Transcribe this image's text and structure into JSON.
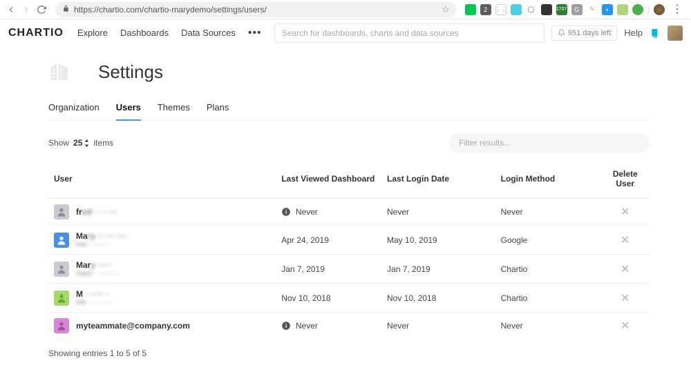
{
  "browser": {
    "url": "https://chartio.com/chartio-marydemo/settings/users/"
  },
  "topnav": {
    "logo": "CHARTIO",
    "links": [
      "Explore",
      "Dashboards",
      "Data Sources"
    ],
    "search_placeholder": "Search for dashboards, charts and data sources",
    "days_left": "951 days left",
    "help": "Help"
  },
  "page": {
    "title": "Settings",
    "tabs": [
      "Organization",
      "Users",
      "Themes",
      "Plans"
    ],
    "active_tab": 1,
    "show_label": "Show",
    "show_value": "25",
    "items_label": "items",
    "filter_placeholder": "Filter results...",
    "columns": {
      "user": "User",
      "last_viewed": "Last Viewed Dashboard",
      "last_login": "Last Login Date",
      "login_method": "Login Method",
      "delete": "Delete User"
    },
    "rows": [
      {
        "name": "fr",
        "name_blur": "ed  ·  · ·  ···",
        "email": "",
        "avatar_bg": "#c8ccd0",
        "avatar_fg": "#88909a",
        "info": true,
        "last_viewed": "Never",
        "last_login": "Never",
        "login_method": "Never"
      },
      {
        "name": "Ma",
        "name_blur": "ry ·· ···  ····",
        "email": "ma·· ········",
        "avatar_bg": "#4a90e2",
        "avatar_fg": "#ffffff",
        "info": false,
        "last_viewed": "Apr 24, 2019",
        "last_login": "May 10, 2019",
        "login_method": "Google"
      },
      {
        "name": "Mar",
        "name_blur": "y ·····",
        "email": "mary·· ·········",
        "avatar_bg": "#c8ccd0",
        "avatar_fg": "#88909a",
        "info": false,
        "last_viewed": "Jan 7, 2019",
        "last_login": "Jan 7, 2019",
        "login_method": "Chartio"
      },
      {
        "name": "M ",
        "name_blur": "· ·····  ·",
        "email": "mk··· ········",
        "avatar_bg": "#a7d96a",
        "avatar_fg": "#6aa830",
        "info": false,
        "last_viewed": "Nov 10, 2018",
        "last_login": "Nov 10, 2018",
        "login_method": "Chartio"
      },
      {
        "name": "myteammate@company.com",
        "name_blur": "",
        "email": "",
        "avatar_bg": "#d687d6",
        "avatar_fg": "#a050a0",
        "info": true,
        "last_viewed": "Never",
        "last_login": "Never",
        "login_method": "Never"
      }
    ],
    "footer": "Showing entries 1 to 5 of 5"
  }
}
